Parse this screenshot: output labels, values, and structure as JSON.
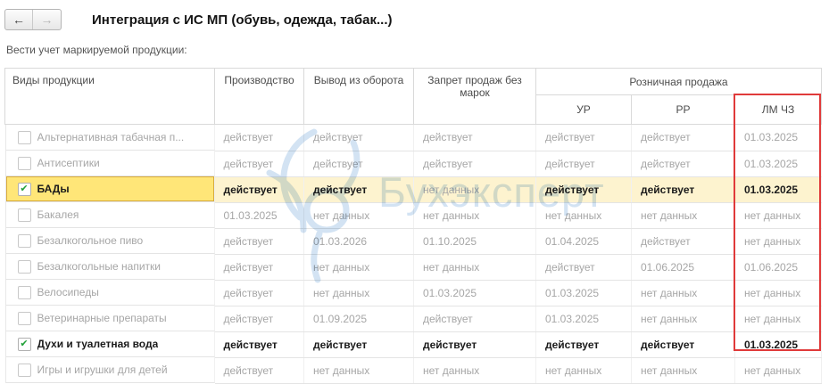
{
  "colors": {
    "highlight_red": "#e03a3a",
    "selection_row_bg": "#fdf3cf",
    "selection_cell_bg": "#ffe678",
    "selection_cell_border": "#d8ab3a",
    "watermark_blue": "#a8c8e8",
    "check_green": "#21a038"
  },
  "header": {
    "back_icon": "←",
    "forward_icon": "→",
    "title": "Интеграция с ИС МП (обувь, одежда, табак...)"
  },
  "subtitle": "Вести учет маркируемой продукции:",
  "table": {
    "columns": [
      "Виды продукции",
      "Производство",
      "Вывод из оборота",
      "Запрет продаж без марок"
    ],
    "group_header": "Розничная продажа",
    "sub_columns": [
      "УР",
      "РР",
      "ЛМ ЧЗ"
    ],
    "no_data_label": "нет данных",
    "rows": [
      {
        "name": "Альтернативная табачная п...",
        "checked": false,
        "selected": false,
        "values": [
          "действует",
          "действует",
          "действует",
          "действует",
          "действует",
          "01.03.2025"
        ]
      },
      {
        "name": "Антисептики",
        "checked": false,
        "selected": false,
        "values": [
          "действует",
          "действует",
          "действует",
          "действует",
          "действует",
          "01.03.2025"
        ]
      },
      {
        "name": "БАДы",
        "checked": true,
        "selected": true,
        "values": [
          "действует",
          "действует",
          "нет данных",
          "действует",
          "действует",
          "01.03.2025"
        ]
      },
      {
        "name": "Бакалея",
        "checked": false,
        "selected": false,
        "values": [
          "01.03.2025",
          "нет данных",
          "нет данных",
          "нет данных",
          "нет данных",
          "нет данных"
        ]
      },
      {
        "name": "Безалкогольное пиво",
        "checked": false,
        "selected": false,
        "values": [
          "действует",
          "01.03.2026",
          "01.10.2025",
          "01.04.2025",
          "действует",
          "нет данных"
        ]
      },
      {
        "name": "Безалкогольные напитки",
        "checked": false,
        "selected": false,
        "values": [
          "действует",
          "нет данных",
          "нет данных",
          "действует",
          "01.06.2025",
          "01.06.2025"
        ]
      },
      {
        "name": "Велосипеды",
        "checked": false,
        "selected": false,
        "values": [
          "действует",
          "нет данных",
          "01.03.2025",
          "01.03.2025",
          "нет данных",
          "нет данных"
        ]
      },
      {
        "name": "Ветеринарные препараты",
        "checked": false,
        "selected": false,
        "values": [
          "действует",
          "01.09.2025",
          "действует",
          "01.03.2025",
          "нет данных",
          "нет данных"
        ]
      },
      {
        "name": "Духи и туалетная вода",
        "checked": true,
        "selected": false,
        "values": [
          "действует",
          "действует",
          "действует",
          "действует",
          "действует",
          "01.03.2025"
        ]
      },
      {
        "name": "Игры и игрушки для детей",
        "checked": false,
        "selected": false,
        "values": [
          "действует",
          "нет данных",
          "нет данных",
          "нет данных",
          "нет данных",
          "нет данных"
        ]
      }
    ]
  },
  "watermark": {
    "text": "Бухэксперт"
  }
}
